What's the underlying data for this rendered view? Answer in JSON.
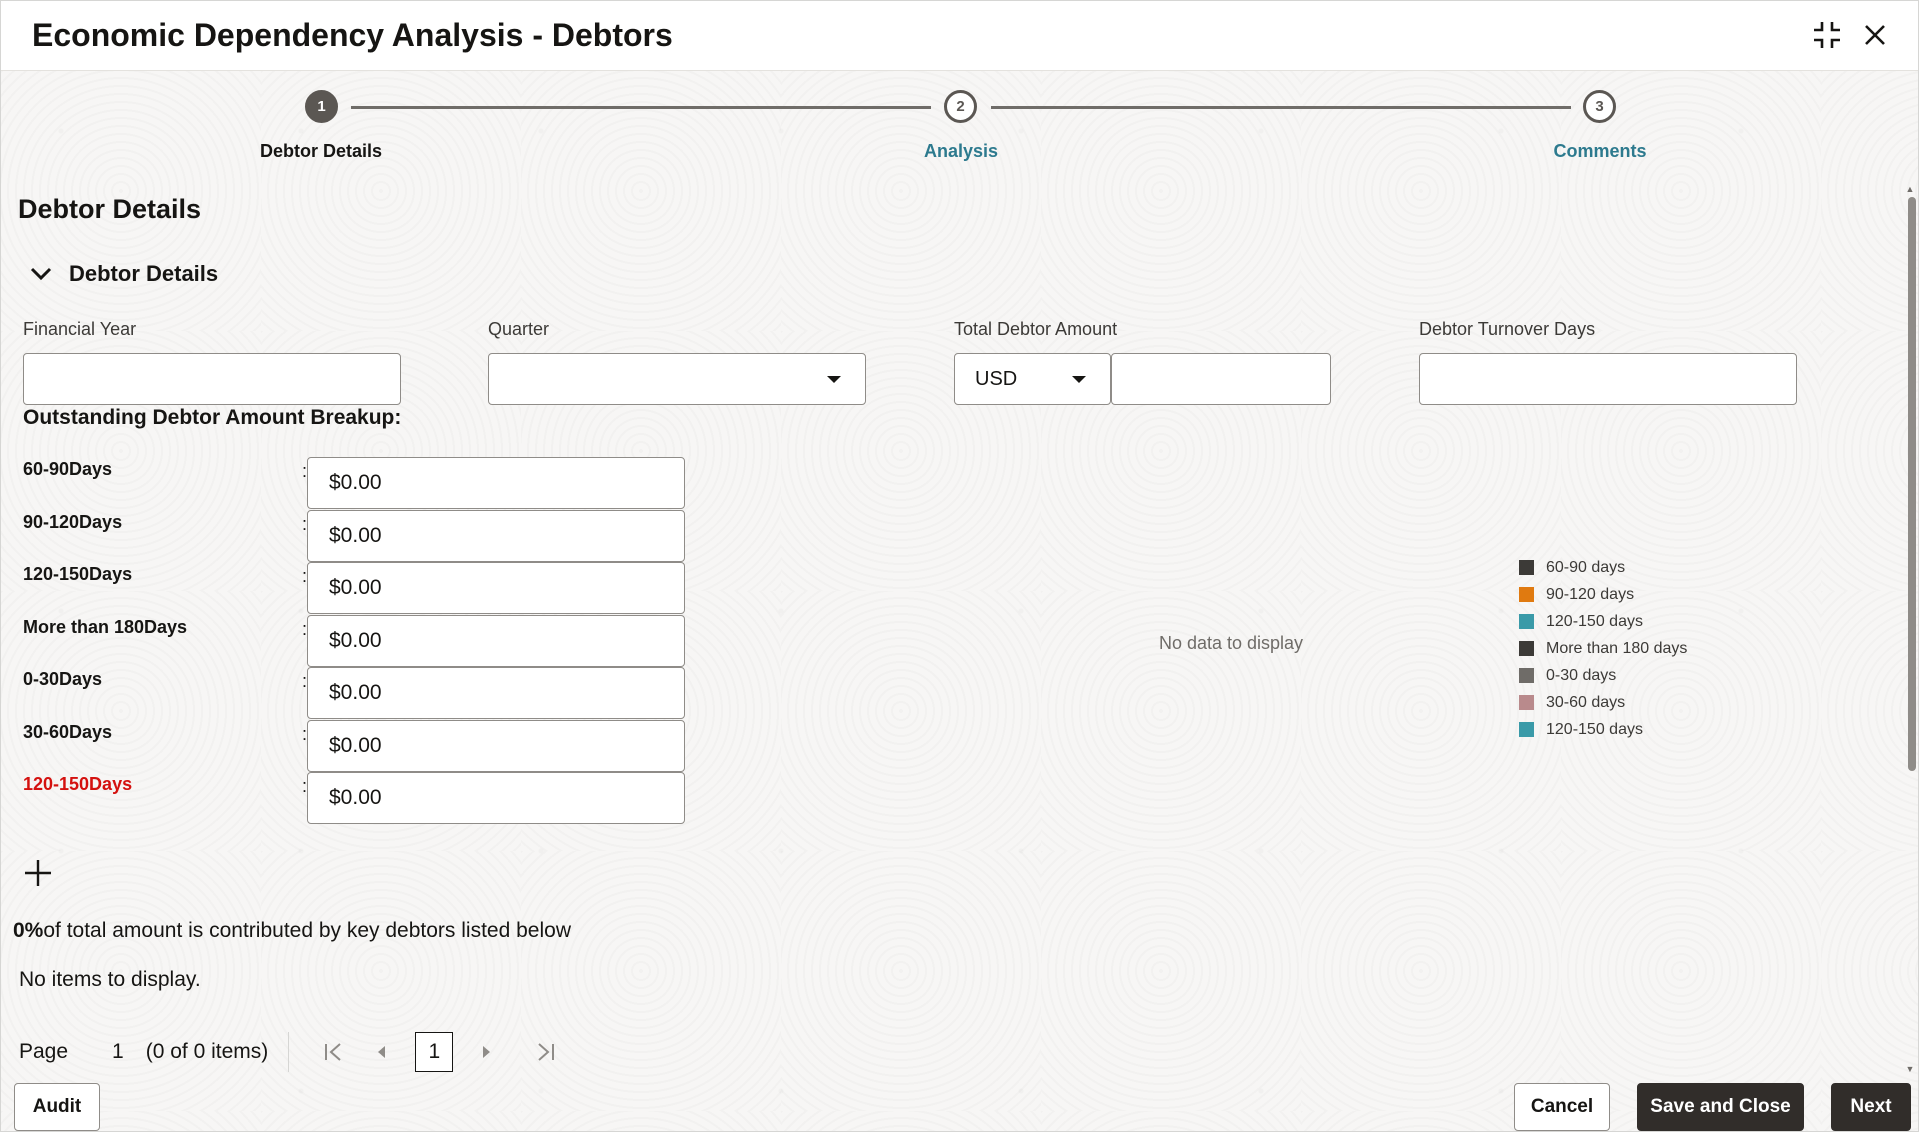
{
  "dialog": {
    "title": "Economic Dependency Analysis - Debtors",
    "icons": [
      "collapse-icon",
      "close-icon"
    ]
  },
  "stepper": {
    "steps": [
      {
        "number": "1",
        "label": "Debtor Details",
        "state": "active"
      },
      {
        "number": "2",
        "label": "Analysis",
        "state": "link"
      },
      {
        "number": "3",
        "label": "Comments",
        "state": "link"
      }
    ]
  },
  "section": {
    "title": "Debtor Details",
    "sub_title": "Debtor Details"
  },
  "fields": {
    "financial_year": {
      "label": "Financial Year",
      "value": ""
    },
    "quarter": {
      "label": "Quarter",
      "value": ""
    },
    "total_debtor_amount": {
      "label": "Total Debtor Amount",
      "currency": "USD",
      "value": ""
    },
    "turnover_days": {
      "label": "Debtor Turnover Days",
      "value": ""
    }
  },
  "breakup": {
    "title": "Outstanding Debtor Amount Breakup:",
    "rows": [
      {
        "label": "60-90Days",
        "value": "$0.00",
        "highlight": false
      },
      {
        "label": "90-120Days",
        "value": "$0.00",
        "highlight": false
      },
      {
        "label": "120-150Days",
        "value": "$0.00",
        "highlight": false
      },
      {
        "label": "More than 180Days",
        "value": "$0.00",
        "highlight": false
      },
      {
        "label": "0-30Days",
        "value": "$0.00",
        "highlight": false
      },
      {
        "label": "30-60Days",
        "value": "$0.00",
        "highlight": false
      },
      {
        "label": "120-150Days",
        "value": "$0.00",
        "highlight": true
      }
    ]
  },
  "chart": {
    "no_data": "No data to display",
    "legend": [
      {
        "label": "60-90 days",
        "color": "#3c3a37"
      },
      {
        "label": "90-120 days",
        "color": "#e07a10"
      },
      {
        "label": "120-150 days",
        "color": "#3a9aa8"
      },
      {
        "label": "More than 180 days",
        "color": "#3c3a37"
      },
      {
        "label": "0-30 days",
        "color": "#6f6c68"
      },
      {
        "label": "30-60 days",
        "color": "#b98a8c"
      },
      {
        "label": "120-150 days",
        "color": "#3a9aa8"
      }
    ]
  },
  "key_debtors": {
    "percent": "0%",
    "summary_text": "of total amount is contributed by key debtors listed below",
    "empty_text": "No items to display."
  },
  "pagination": {
    "page_label": "Page",
    "page_number": "1",
    "items_text": "(0 of 0 items)",
    "current": "1"
  },
  "footer": {
    "audit": "Audit",
    "cancel": "Cancel",
    "save_close": "Save and Close",
    "next": "Next"
  }
}
